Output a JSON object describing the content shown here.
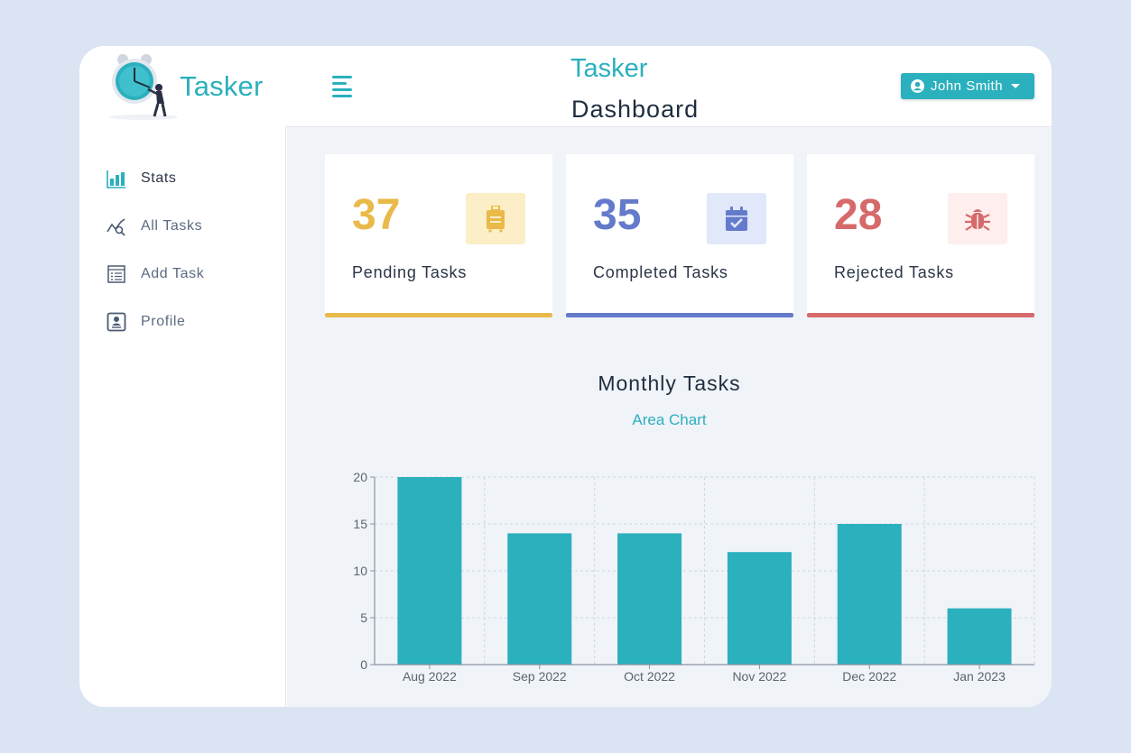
{
  "app": {
    "brand": "Tasker"
  },
  "header": {
    "app_name": "Tasker",
    "page_title": "Dashboard"
  },
  "user": {
    "name": "John Smith"
  },
  "sidebar": {
    "items": [
      {
        "label": "Stats",
        "icon": "bar-chart-icon",
        "active": true
      },
      {
        "label": "All Tasks",
        "icon": "trend-search-icon",
        "active": false
      },
      {
        "label": "Add Task",
        "icon": "task-list-icon",
        "active": false
      },
      {
        "label": "Profile",
        "icon": "profile-card-icon",
        "active": false
      }
    ]
  },
  "cards": [
    {
      "value": "37",
      "label": "Pending Tasks",
      "icon": "suitcase-icon",
      "color": "#e9b949",
      "bg": "#fcefc7"
    },
    {
      "value": "35",
      "label": "Completed Tasks",
      "icon": "calendar-check-icon",
      "color": "#647acb",
      "bg": "#e0e8f9"
    },
    {
      "value": "28",
      "label": "Rejected Tasks",
      "icon": "bug-icon",
      "color": "#d66a6a",
      "bg": "#ffeeee"
    }
  ],
  "chart": {
    "title": "Monthly Tasks",
    "subtitle": "Area Chart"
  },
  "chart_data": {
    "type": "bar",
    "categories": [
      "Aug 2022",
      "Sep 2022",
      "Oct 2022",
      "Nov 2022",
      "Dec 2022",
      "Jan 2023"
    ],
    "values": [
      20,
      14,
      14,
      12,
      15,
      6
    ],
    "yticks": [
      0,
      5,
      10,
      15,
      20
    ],
    "ylim": [
      0,
      20
    ],
    "grid": true,
    "color": "#2bb0bd"
  },
  "colors": {
    "accent": "#2bb0bd",
    "background": "#dbe4f3",
    "main_bg": "#f0f3f8"
  }
}
